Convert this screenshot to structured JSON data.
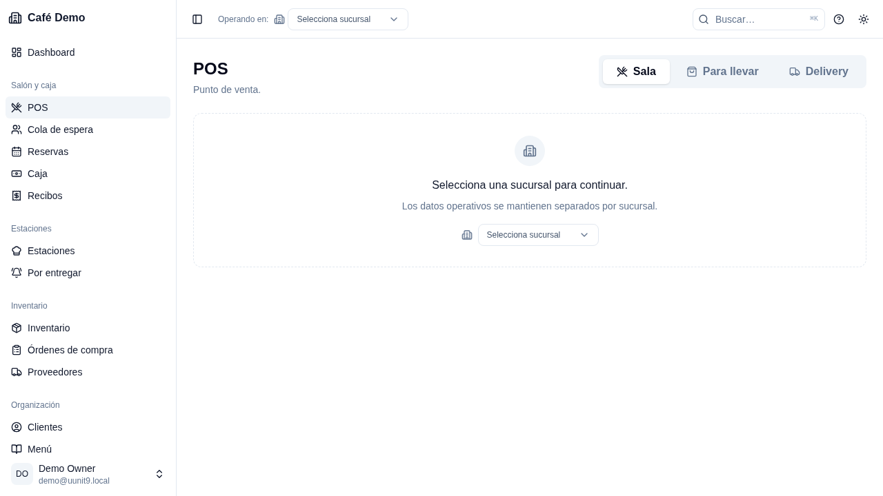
{
  "sidebar": {
    "brand": "Café Demo",
    "groups": [
      {
        "items": [
          {
            "label": "Dashboard",
            "selected": false
          }
        ]
      },
      {
        "title": "Salón y caja",
        "items": [
          {
            "label": "POS",
            "selected": true
          },
          {
            "label": "Cola de espera",
            "selected": false
          },
          {
            "label": "Reservas",
            "selected": false
          },
          {
            "label": "Caja",
            "selected": false
          },
          {
            "label": "Recibos",
            "selected": false
          }
        ]
      },
      {
        "title": "Estaciones",
        "items": [
          {
            "label": "Estaciones",
            "selected": false
          },
          {
            "label": "Por entregar",
            "selected": false
          }
        ]
      },
      {
        "title": "Inventario",
        "items": [
          {
            "label": "Inventario",
            "selected": false
          },
          {
            "label": "Órdenes de compra",
            "selected": false
          },
          {
            "label": "Proveedores",
            "selected": false
          }
        ]
      },
      {
        "title": "Organización",
        "items": [
          {
            "label": "Clientes",
            "selected": false
          },
          {
            "label": "Menú",
            "selected": false
          }
        ]
      }
    ],
    "user": {
      "initials": "DO",
      "name": "Demo Owner",
      "email": "demo@uunit9.local"
    }
  },
  "topbar": {
    "operating_label": "Operando en:",
    "branch_select": {
      "placeholder": "Selecciona sucursal"
    },
    "search": {
      "placeholder": "Buscar…",
      "shortcut": "⌘K"
    }
  },
  "page": {
    "title": "POS",
    "subtitle": "Punto de venta.",
    "tabs": [
      {
        "label": "Sala",
        "selected": true
      },
      {
        "label": "Para llevar",
        "selected": false
      },
      {
        "label": "Delivery",
        "selected": false
      }
    ],
    "empty_state": {
      "title": "Selecciona una sucursal para continuar.",
      "description": "Los datos operativos se mantienen separados por sucursal.",
      "branch_select": {
        "placeholder": "Selecciona sucursal"
      }
    }
  }
}
